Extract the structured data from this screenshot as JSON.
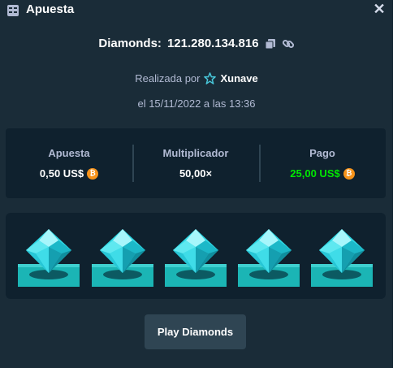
{
  "modal": {
    "title": "Apuesta",
    "close_icon": "close-icon",
    "header_icon": "bet-slip-icon"
  },
  "game": {
    "name": "Diamonds:",
    "id": "121.280.134.816",
    "copy_icon": "copy-icon",
    "link_icon": "link-icon"
  },
  "placed": {
    "prefix": "Realizada por",
    "user": "Xunave",
    "user_icon": "star-icon",
    "date": "el 15/11/2022 a las 13:36"
  },
  "stats": [
    {
      "label": "Apuesta",
      "value": "0,50 US$",
      "coin": true,
      "color": "#ffffff"
    },
    {
      "label": "Multiplicador",
      "value": "50,00×",
      "coin": false,
      "color": "#ffffff"
    },
    {
      "label": "Pago",
      "value": "25,00 US$",
      "coin": true,
      "color": "#00e701"
    }
  ],
  "board": {
    "gems": [
      "diamond-icon",
      "diamond-icon",
      "diamond-icon",
      "diamond-icon",
      "diamond-icon"
    ],
    "gem_color": "#2fd8e4",
    "pad_color": "#1bb5b5"
  },
  "play_button": {
    "label": "Play Diamonds"
  },
  "colors": {
    "background": "#1a2c38",
    "panel": "#0f212e",
    "button": "#2f4553",
    "muted_text": "#b1bad3",
    "win_green": "#00e701",
    "coin": "#f7931a"
  }
}
